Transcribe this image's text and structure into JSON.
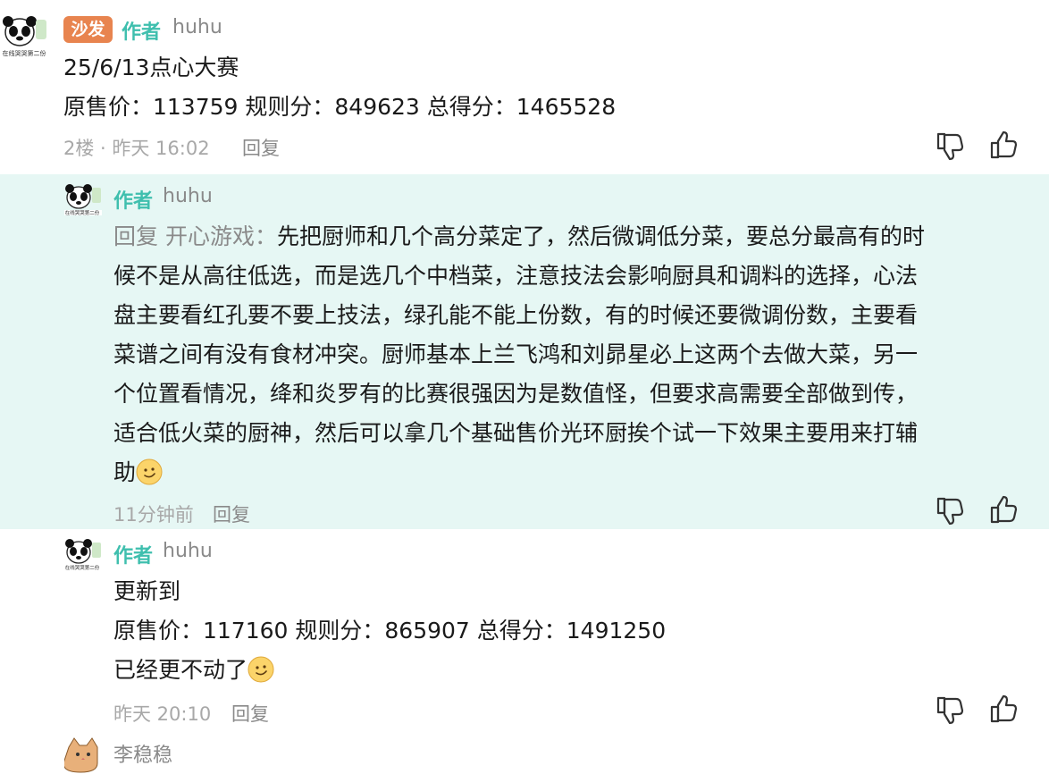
{
  "sofa_comment": {
    "badge": "沙发",
    "author_tag": "作者",
    "username": "huhu",
    "avatar_caption": "在线哭哭第二份",
    "title": "25/6/13点心大赛",
    "stats": "原售价：113759 规则分：849623 总得分：1465528",
    "floor_time": "2楼 · 昨天 16:02",
    "reply_label": "回复"
  },
  "reply1": {
    "author_tag": "作者",
    "username": "huhu",
    "avatar_caption": "在线哭哭第二份",
    "reply_prefix": "回复 开心游戏：",
    "lines": [
      "先把厨师和几个高分菜定了，然后微调低分菜，要总分最高有的时",
      "候不是从高往低选，而是选几个中档菜，注意技法会影响厨具和调料的选择，心法",
      "盘主要看红孔要不要上技法，绿孔能不能上份数，有的时候还要微调份数，主要看",
      "菜谱之间有没有食材冲突。厨师基本上兰飞鸿和刘昴星必上这两个去做大菜，另一",
      "个位置看情况，绛和炎罗有的比赛很强因为是数值怪，但要求高需要全部做到传，",
      "适合低火菜的厨神，然后可以拿几个基础售价光环厨挨个试一下效果主要用来打辅",
      "助"
    ],
    "time": "11分钟前",
    "reply_label": "回复"
  },
  "reply2": {
    "author_tag": "作者",
    "username": "huhu",
    "avatar_caption": "在线哭哭第二份",
    "line1": "更新到",
    "line2": "原售价：117160 规则分：865907 总得分：1491250",
    "line3": "已经更不动了",
    "time": "昨天 20:10",
    "reply_label": "回复"
  },
  "reply3": {
    "username": "李稳稳"
  },
  "colors": {
    "accent": "#3fbfae",
    "badge": "#e8844f",
    "highlight_bg": "#e6f7f4",
    "muted": "#a8a8a8"
  },
  "icons": [
    "dislike-icon",
    "like-icon",
    "smile-emoji-icon",
    "panda-avatar",
    "cat-avatar"
  ]
}
